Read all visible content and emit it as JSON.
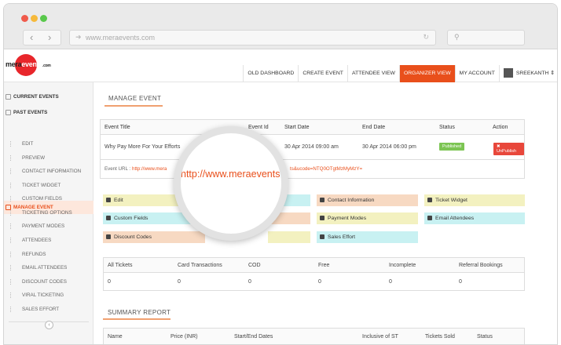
{
  "browser": {
    "url": "www.meraevents.com"
  },
  "logo": {
    "text_pre": "mera",
    "text_mid": "events",
    "text_post": ".com"
  },
  "topnav": {
    "items": [
      "OLD DASHBOARD",
      "CREATE EVENT",
      "ATTENDEE VIEW",
      "ORGANIZER VIEW",
      "MY ACCOUNT"
    ],
    "user": "SREEKANTH",
    "active_color": "#e94f1b"
  },
  "sidebar": {
    "top_items": [
      "CURRENT EVENTS",
      "PAST EVENTS",
      "MANAGE EVENT"
    ],
    "sub_items": [
      "EDIT",
      "PREVIEW",
      "CONTACT INFORMATION",
      "TICKET WIDGET",
      "CUSTOM FIELDS",
      "TICKETING OPTIONS",
      "PAYMENT MODES",
      "ATTENDEES",
      "REFUNDS",
      "EMAIL ATTENDEES",
      "DISCOUNT CODES",
      "VIRAL TICKETING",
      "SALES EFFORT"
    ]
  },
  "manage": {
    "title": "MANAGE EVENT",
    "headers": [
      "Event Title",
      "Event Id",
      "Start Date",
      "End Date",
      "Status",
      "Action"
    ],
    "row": {
      "title": "Why Pay More For Your Efforts",
      "start": "30 Apr 2014 09:00 am",
      "end": "30 Apr 2014 06:00 pm",
      "status": "Published",
      "action": "UnPublish"
    },
    "url_label": "Event URL :",
    "url_left": "http://www.mera",
    "url_right": "ts&ucode=NTQ0OTgtMzMyMzY="
  },
  "magnifier": {
    "text": "http://www.meraevents"
  },
  "tiles": {
    "edit": "Edit",
    "contact": "Contact Information",
    "ticket_widget": "Ticket Widget",
    "custom_fields": "Custom Fields",
    "payment_modes": "Payment Modes",
    "email_attendees": "Email Attendees",
    "discount_codes": "Discount Codes",
    "sales_effort": "Sales Effort"
  },
  "colors": {
    "yellow": "#f3f1c0",
    "cyan": "#c8f1f2",
    "peach": "#f7d9c2",
    "published": "#7cc553",
    "unpublish": "#e8473b"
  },
  "stats": {
    "headers": [
      "All Tickets",
      "Card Transactions",
      "COD",
      "Free",
      "Incomplete",
      "Referral Bookings"
    ],
    "values": [
      "0",
      "0",
      "0",
      "0",
      "0",
      "0"
    ]
  },
  "summary": {
    "title": "SUMMARY REPORT",
    "headers": [
      "Name",
      "Price (INR)",
      "Start/End Dates",
      "Inclusive of ST",
      "Tickets Sold",
      "Status"
    ]
  }
}
